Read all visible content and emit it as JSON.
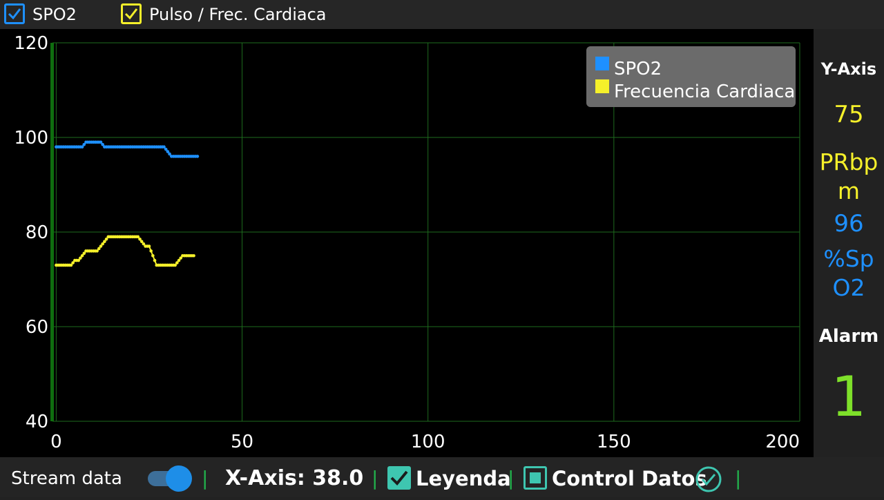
{
  "topbar": {
    "spo2_checkbox": {
      "label": "SPO2",
      "checked": true,
      "color": "#1e90ff"
    },
    "pulse_checkbox": {
      "label": "Pulso / Frec. Cardiaca",
      "checked": true,
      "color": "#f5f02a"
    }
  },
  "chart_data": {
    "type": "line",
    "x_ticks": [
      "0",
      "50",
      "100",
      "150",
      "200"
    ],
    "y_ticks": [
      "40",
      "60",
      "80",
      "100",
      "120"
    ],
    "xlim": [
      -1,
      200
    ],
    "ylim": [
      40,
      120
    ],
    "grid": true,
    "legend_position": "top-right",
    "series": [
      {
        "name": "SPO2",
        "color": "#1e90ff",
        "x": [
          0,
          1,
          2,
          3,
          4,
          5,
          6,
          7,
          8,
          9,
          10,
          11,
          12,
          13,
          14,
          15,
          16,
          17,
          18,
          19,
          20,
          21,
          22,
          23,
          24,
          25,
          26,
          27,
          28,
          29,
          30,
          31,
          32,
          33,
          34,
          35,
          36,
          37,
          38
        ],
        "y": [
          98,
          98,
          98,
          98,
          98,
          98,
          98,
          98,
          99,
          99,
          99,
          99,
          99,
          98,
          98,
          98,
          98,
          98,
          98,
          98,
          98,
          98,
          98,
          98,
          98,
          98,
          98,
          98,
          98,
          98,
          97,
          96,
          96,
          96,
          96,
          96,
          96,
          96,
          96
        ]
      },
      {
        "name": "Frecuencia Cardiaca",
        "color": "#f5f02a",
        "x": [
          0,
          1,
          2,
          3,
          4,
          5,
          6,
          7,
          8,
          9,
          10,
          11,
          12,
          13,
          14,
          15,
          16,
          17,
          18,
          19,
          20,
          21,
          22,
          23,
          24,
          25,
          26,
          27,
          28,
          29,
          30,
          31,
          32,
          33,
          34,
          35,
          36,
          37
        ],
        "y": [
          73,
          73,
          73,
          73,
          73,
          74,
          74,
          75,
          76,
          76,
          76,
          76,
          77,
          78,
          79,
          79,
          79,
          79,
          79,
          79,
          79,
          79,
          79,
          78,
          77,
          77,
          75,
          73,
          73,
          73,
          73,
          73,
          73,
          74,
          75,
          75,
          75,
          75
        ]
      }
    ]
  },
  "right_panel": {
    "y_axis_title": "Y-Axis",
    "y_axis_value": "75",
    "pr_label": "PRbpm",
    "spo2_value": "96",
    "spo2_label": "%SpO2",
    "alarm_title": "Alarm",
    "alarm_value": "1"
  },
  "bottombar": {
    "stream_label": "Stream data",
    "stream_on": true,
    "separator": "|",
    "x_axis_label": "X-Axis: 38.0",
    "leyenda_label": "Leyenda",
    "leyenda_checked": true,
    "control_label": "Control Datos",
    "control_checked": false,
    "accent_color": "#3ec6b0"
  }
}
